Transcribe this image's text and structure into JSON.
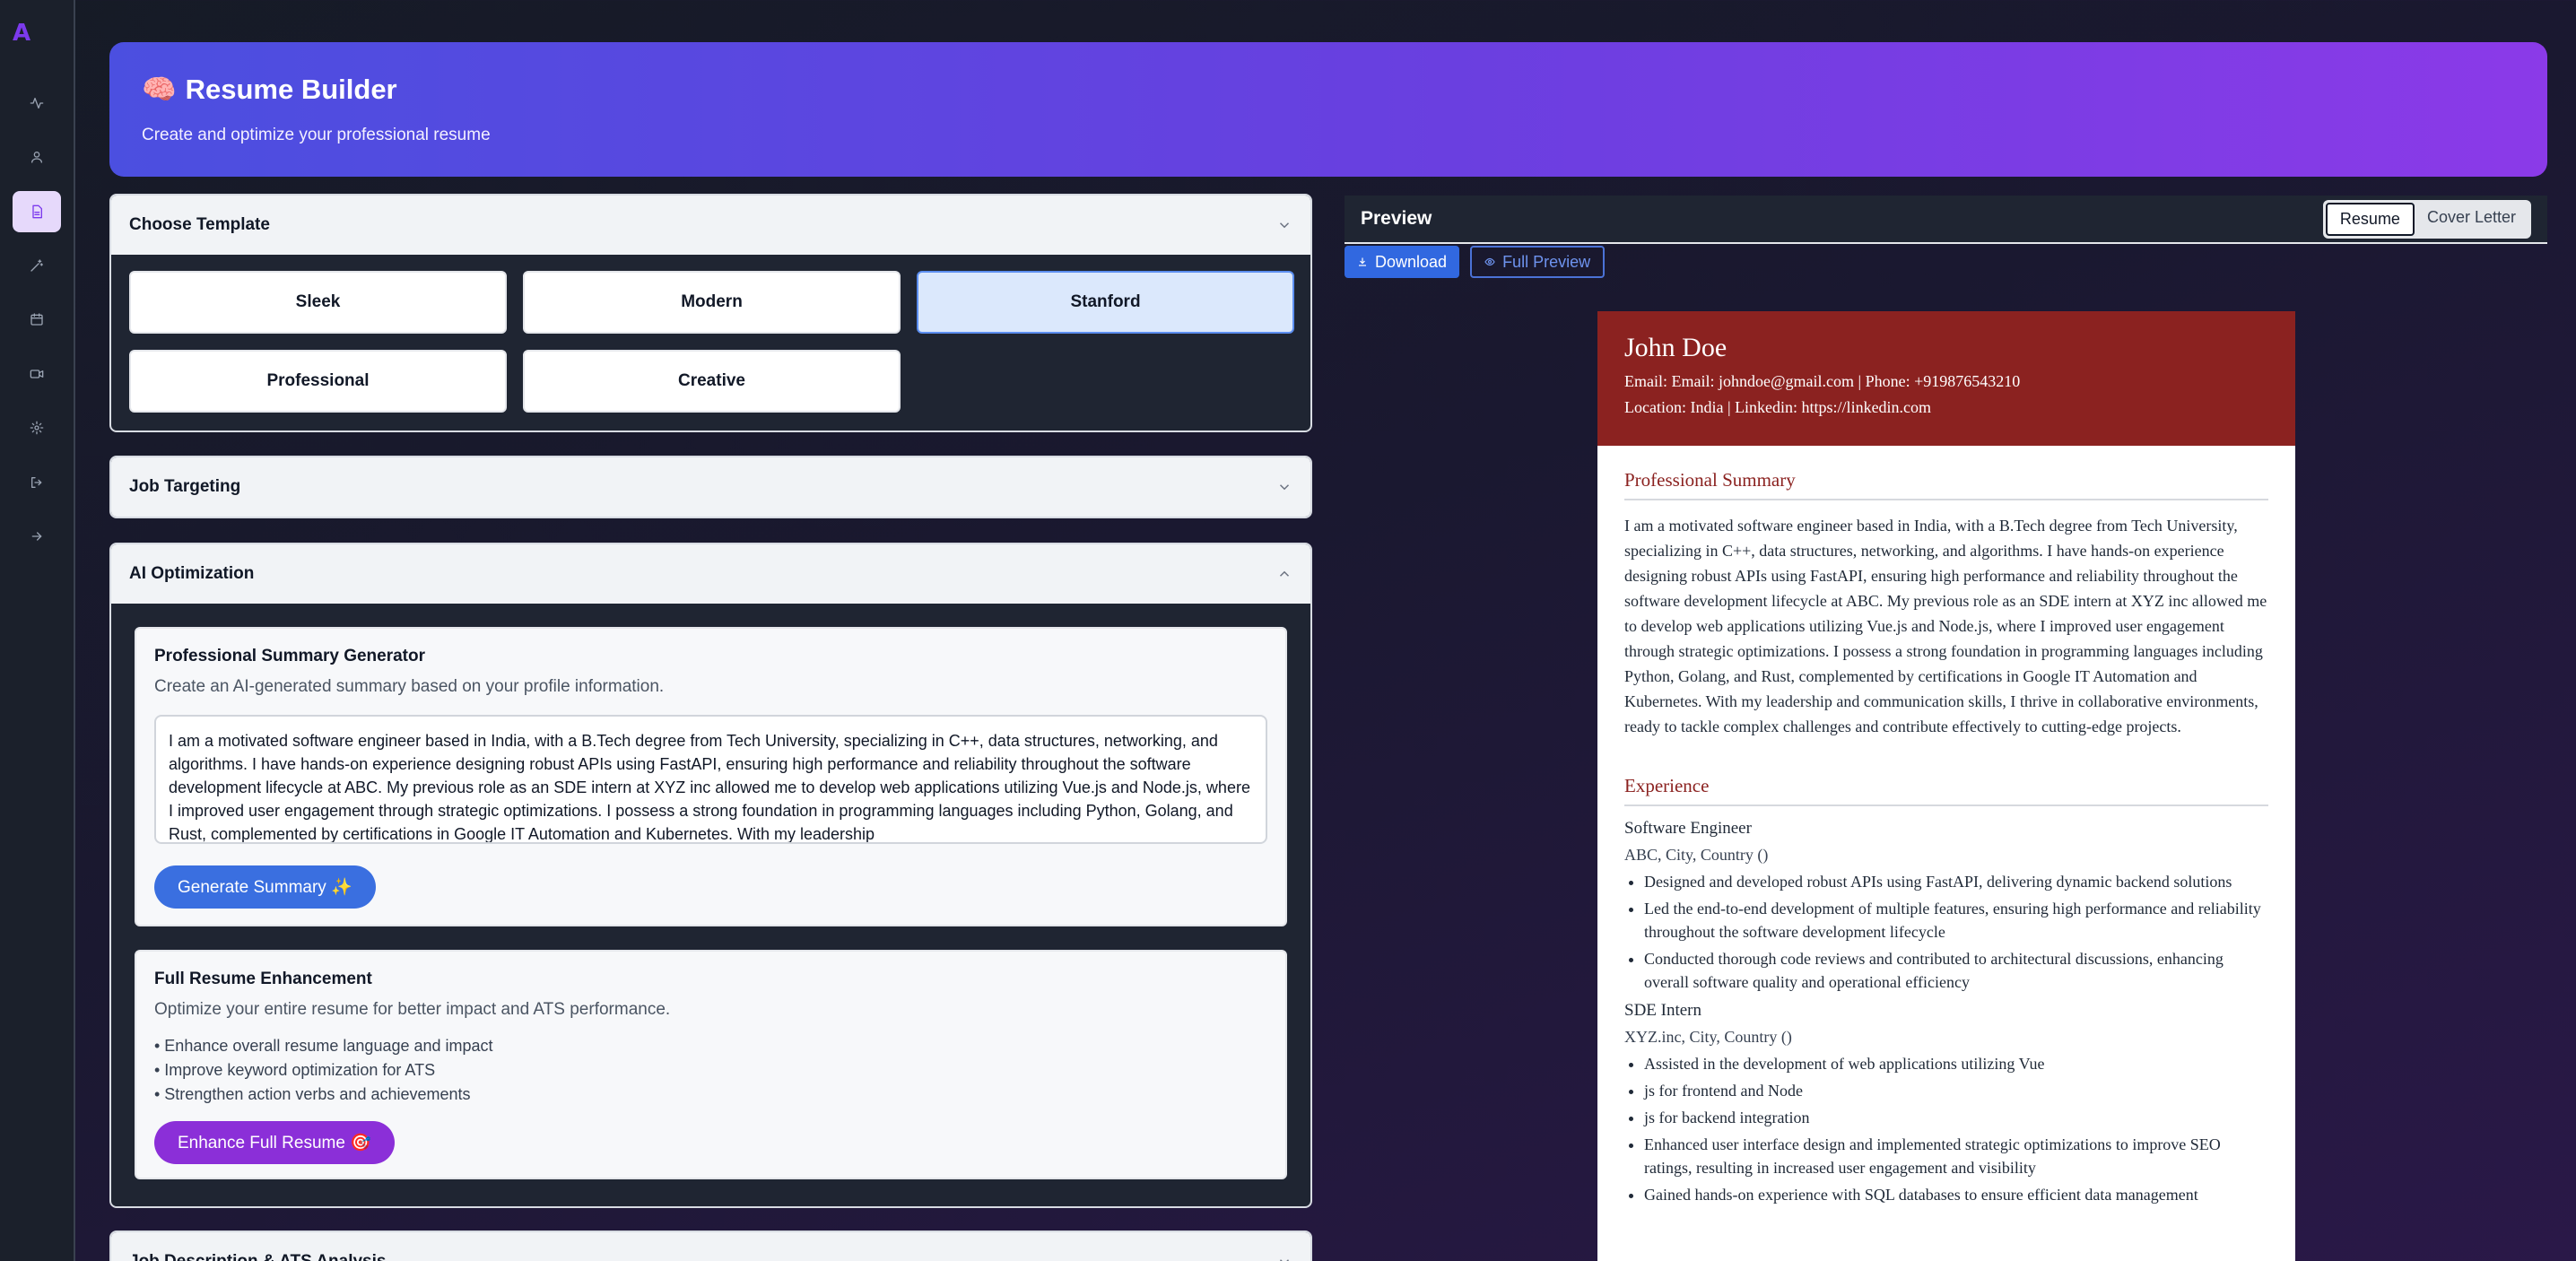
{
  "app": {
    "logo": "A",
    "title": "Resume Builder",
    "title_emoji": "🧠",
    "subtitle": "Create and optimize your professional resume"
  },
  "sidebar": {
    "items": [
      {
        "icon": "activity-icon"
      },
      {
        "icon": "user-icon"
      },
      {
        "icon": "document-icon",
        "active": true
      },
      {
        "icon": "magic-wand-icon"
      },
      {
        "icon": "calendar-icon"
      },
      {
        "icon": "video-icon"
      },
      {
        "icon": "settings-icon"
      },
      {
        "icon": "logout-icon"
      },
      {
        "icon": "arrow-right-icon"
      }
    ]
  },
  "templates": {
    "title": "Choose Template",
    "options": [
      "Sleek",
      "Modern",
      "Stanford",
      "Professional",
      "Creative"
    ],
    "selected": "Stanford"
  },
  "job_targeting": {
    "title": "Job Targeting"
  },
  "ai_optimization": {
    "title": "AI Optimization",
    "summary_generator": {
      "title": "Professional Summary Generator",
      "description": "Create an AI-generated summary based on your profile information.",
      "text": "I am a motivated software engineer based in India, with a B.Tech degree from Tech University, specializing in C++, data structures, networking, and algorithms. I have hands-on experience designing robust APIs using FastAPI, ensuring high performance and reliability throughout the software development lifecycle at ABC. My previous role as an SDE intern at XYZ inc allowed me to develop web applications utilizing Vue.js and Node.js, where I improved user engagement through strategic optimizations. I possess a strong foundation in programming languages including Python, Golang, and Rust, complemented by certifications in Google IT Automation and Kubernetes. With my leadership",
      "button": "Generate Summary ✨"
    },
    "full_enhancement": {
      "title": "Full Resume Enhancement",
      "description": "Optimize your entire resume for better impact and ATS performance.",
      "bullets": [
        "• Enhance overall resume language and impact",
        "• Improve keyword optimization for ATS",
        "• Strengthen action verbs and achievements"
      ],
      "button": "Enhance Full Resume 🎯"
    }
  },
  "jd_ats": {
    "title": "Job Description & ATS Analysis"
  },
  "preview": {
    "title": "Preview",
    "tabs": [
      "Resume",
      "Cover Letter"
    ],
    "active_tab": "Resume",
    "download": "Download",
    "full_preview": "Full Preview"
  },
  "resume": {
    "name": "John Doe",
    "contact_line1": "Email: Email: johndoe@gmail.com | Phone: +919876543210",
    "contact_line2": "Location: India | Linkedin: https://linkedin.com",
    "summary_title": "Professional Summary",
    "summary": "I am a motivated software engineer based in India, with a B.Tech degree from Tech University, specializing in C++, data structures, networking, and algorithms. I have hands-on experience designing robust APIs using FastAPI, ensuring high performance and reliability throughout the software development lifecycle at ABC. My previous role as an SDE intern at XYZ inc allowed me to develop web applications utilizing Vue.js and Node.js, where I improved user engagement through strategic optimizations. I possess a strong foundation in programming languages including Python, Golang, and Rust, complemented by certifications in Google IT Automation and Kubernetes. With my leadership and communication skills, I thrive in collaborative environments, ready to tackle complex challenges and contribute effectively to cutting-edge projects.",
    "experience_title": "Experience",
    "jobs": [
      {
        "title": "Software Engineer",
        "sub": "ABC, City, Country ()",
        "bullets": [
          "Designed and developed robust APIs using FastAPI, delivering dynamic backend solutions",
          "Led the end-to-end development of multiple features, ensuring high performance and reliability throughout the software development lifecycle",
          "Conducted thorough code reviews and contributed to architectural discussions, enhancing overall software quality and operational efficiency"
        ]
      },
      {
        "title": "SDE Intern",
        "sub": "XYZ.inc, City, Country ()",
        "bullets": [
          "Assisted in the development of web applications utilizing Vue",
          "js for frontend and Node",
          "js for backend integration",
          "Enhanced user interface design and implemented strategic optimizations to improve SEO ratings, resulting in increased user engagement and visibility",
          "Gained hands-on experience with SQL databases to ensure efficient data management"
        ]
      }
    ]
  }
}
